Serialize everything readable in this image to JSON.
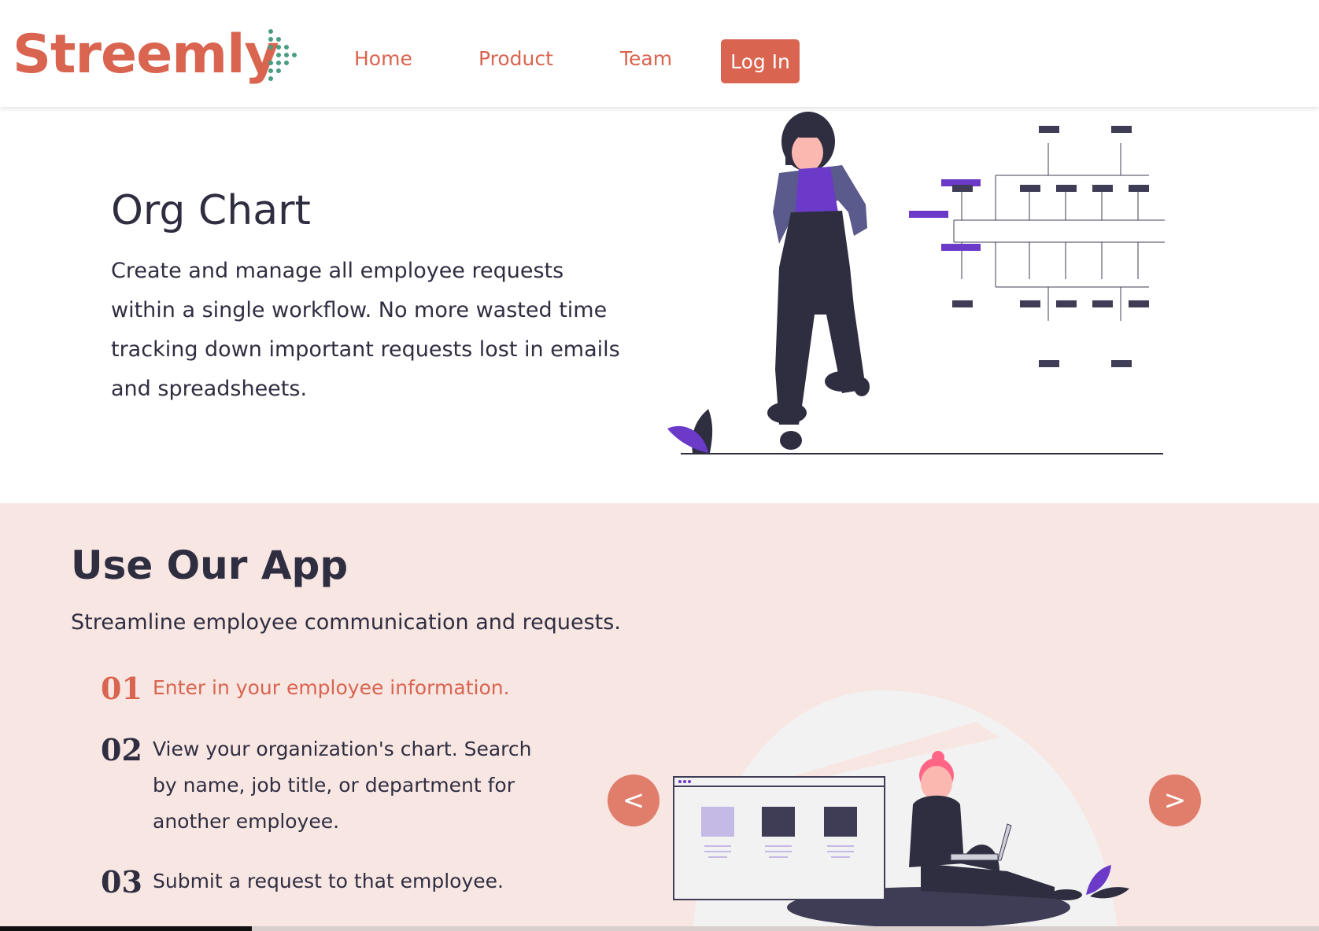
{
  "brand": {
    "name": "Streemly",
    "accent": "#d9644f",
    "dot_color": "#4a9d80"
  },
  "nav": {
    "home": "Home",
    "product": "Product",
    "team": "Team",
    "login": "Log In"
  },
  "org_chart": {
    "title": "Org Chart",
    "description": "Create and manage all employee requests within a single workflow. No more wasted time tracking down important requests lost in emails and spreadsheets.",
    "illustration": "woman-standing-next-to-org-tree-illustration"
  },
  "app": {
    "title": "Use Our App",
    "subtitle": "Streamline employee communication and requests.",
    "steps": [
      {
        "num": "01",
        "text": "Enter in your employee information."
      },
      {
        "num": "02",
        "text": "View your organization's chart. Search by name, job title, or department for another employee."
      },
      {
        "num": "03",
        "text": "Submit a request to that employee."
      }
    ],
    "prev_label": "<",
    "next_label": ">",
    "illustration": "woman-sitting-with-laptop-illustration",
    "background": "#f8e6e3"
  }
}
